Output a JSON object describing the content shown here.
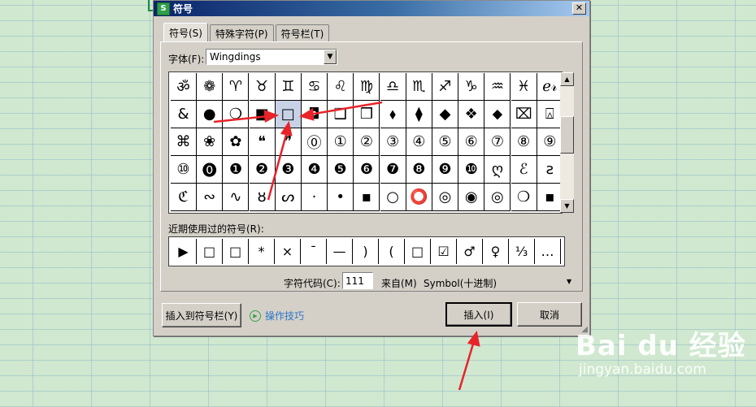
{
  "dialog": {
    "title": "符号",
    "app_icon": "S",
    "close_glyph": "✕"
  },
  "tabs": [
    {
      "label": "符号(S)",
      "active": true
    },
    {
      "label": "特殊字符(P)",
      "active": false
    },
    {
      "label": "符号栏(T)",
      "active": false
    }
  ],
  "font": {
    "label": "字体(F):",
    "value": "Wingdings"
  },
  "symbol_grid": {
    "rows": [
      [
        "ॐ",
        "❁",
        "♈",
        "♉",
        "♊",
        "♋",
        "♌",
        "♍",
        "♎",
        "♏",
        "♐",
        "♑",
        "♒",
        "♓",
        "ℯ𝓇"
      ],
      [
        "&",
        "●",
        "❍",
        "■",
        "□",
        "◘",
        "❑",
        "❒",
        "⬧",
        "⧫",
        "◆",
        "❖",
        "⬥",
        "⌧",
        "⍓"
      ],
      [
        "⌘",
        "❀",
        "✿",
        "❝",
        "❞",
        "⓪",
        "①",
        "②",
        "③",
        "④",
        "⑤",
        "⑥",
        "⑦",
        "⑧",
        "⑨"
      ],
      [
        "⑩",
        "⓿",
        "❶",
        "❷",
        "❸",
        "❹",
        "❺",
        "❻",
        "❼",
        "❽",
        "❾",
        "❿",
        "ღ",
        "ℰ",
        "ƨ"
      ],
      [
        "ℭ",
        "∾",
        "∿",
        "ȣ",
        "ᔕ",
        "·",
        "•",
        "▪",
        "○",
        "⭕",
        "◎",
        "◉",
        "◎",
        "❍",
        "▪"
      ]
    ],
    "selected": {
      "row": 1,
      "col": 4
    }
  },
  "recent": {
    "label": "近期使用过的符号(R):",
    "items": [
      "▶",
      "□",
      "□",
      "*",
      "×",
      "¯",
      "—",
      ")",
      "(",
      "□",
      "☑",
      "♂",
      "♀",
      "⅓",
      "…"
    ]
  },
  "char_code": {
    "label": "字符代码(C):",
    "value": "111",
    "from_label": "来自(M)",
    "from_value": "Symbol(十进制)"
  },
  "buttons": {
    "insert_to_bar": "插入到符号栏(Y)",
    "tips": "操作技巧",
    "insert": "插入(I)",
    "cancel": "取消"
  },
  "watermark": {
    "logo": "Bai  du 经验",
    "sub": "jingyan.baidu.com"
  },
  "colors": {
    "annotation": "#e8232a",
    "title_bar": "#0a246a",
    "tips_link": "#2a76c6"
  }
}
